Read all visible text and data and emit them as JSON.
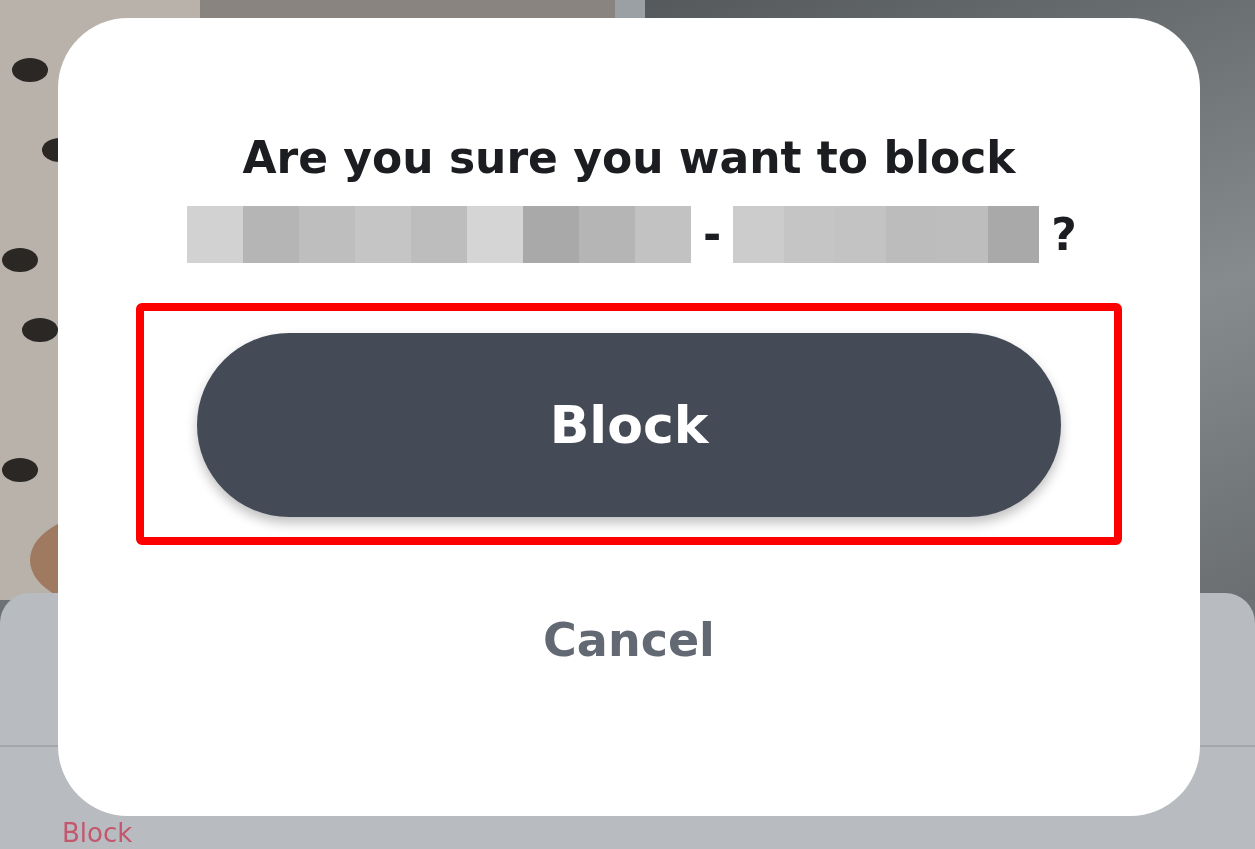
{
  "background": {
    "kind": "picture",
    "sheet_action": "Block"
  },
  "dialog": {
    "question": "Are you sure you want to block",
    "separator": "-",
    "question_mark": "?",
    "primary_button": {
      "label": "Block",
      "highlighted": true
    },
    "secondary_button": {
      "label": "Cancel"
    }
  }
}
